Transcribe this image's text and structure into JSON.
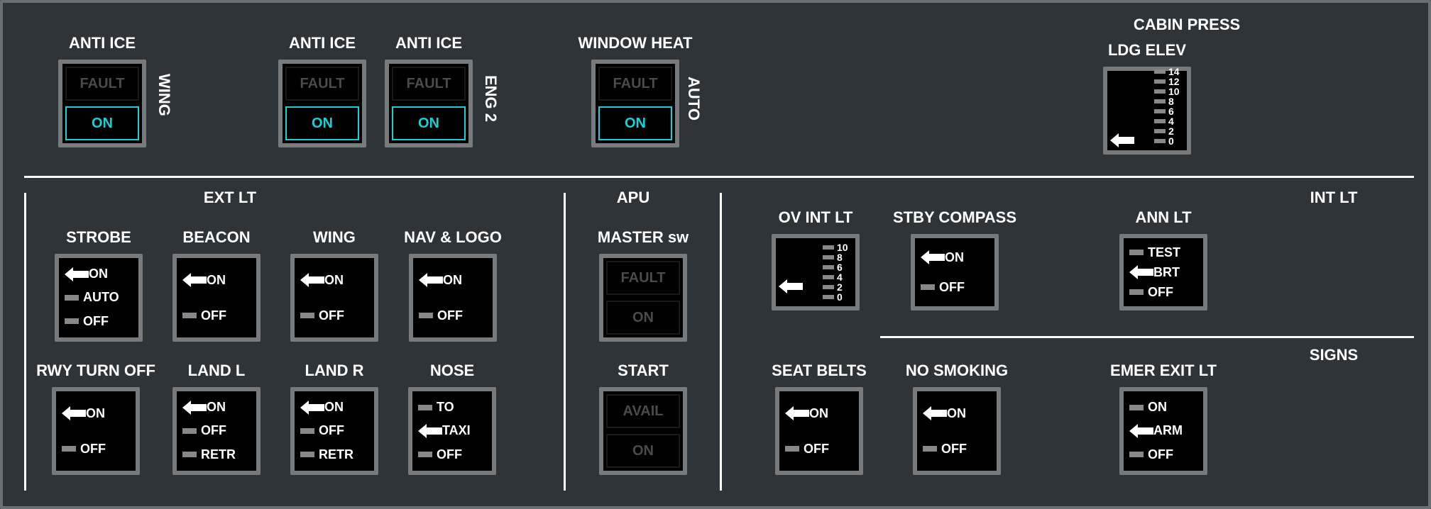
{
  "sections": {
    "cabin_press": "CABIN PRESS",
    "ext_lt": "EXT LT",
    "apu": "APU",
    "int_lt": "INT LT",
    "signs": "SIGNS"
  },
  "anti_ice": {
    "wing": {
      "title": "ANTI ICE",
      "side": "WING",
      "fault": "FAULT",
      "state": "ON"
    },
    "eng1": {
      "title": "ANTI ICE",
      "fault": "FAULT",
      "state": "ON"
    },
    "eng2": {
      "title": "ANTI ICE",
      "side": "ENG 2",
      "fault": "FAULT",
      "state": "ON"
    }
  },
  "window_heat": {
    "title": "WINDOW HEAT",
    "side": "AUTO",
    "fault": "FAULT",
    "state": "ON"
  },
  "ldg_elev": {
    "title": "LDG ELEV",
    "scale": [
      "0",
      "2",
      "4",
      "6",
      "8",
      "10",
      "12",
      "14"
    ],
    "selected_index": 0
  },
  "ext_lt": {
    "strobe": {
      "title": "STROBE",
      "positions": [
        "ON",
        "AUTO",
        "OFF"
      ],
      "selected": "ON"
    },
    "beacon": {
      "title": "BEACON",
      "positions": [
        "ON",
        "OFF"
      ],
      "selected": "ON"
    },
    "wing": {
      "title": "WING",
      "positions": [
        "ON",
        "OFF"
      ],
      "selected": "ON"
    },
    "nav_logo": {
      "title": "NAV & LOGO",
      "positions": [
        "ON",
        "OFF"
      ],
      "selected": "ON"
    },
    "rwy_turn_off": {
      "title": "RWY TURN OFF",
      "positions": [
        "ON",
        "OFF"
      ],
      "selected": "ON"
    },
    "land_l": {
      "title": "LAND L",
      "positions": [
        "ON",
        "OFF",
        "RETR"
      ],
      "selected": "ON"
    },
    "land_r": {
      "title": "LAND R",
      "positions": [
        "ON",
        "OFF",
        "RETR"
      ],
      "selected": "ON"
    },
    "nose": {
      "title": "NOSE",
      "positions": [
        "TO",
        "TAXI",
        "OFF"
      ],
      "selected": "TAXI"
    }
  },
  "apu": {
    "master": {
      "title": "MASTER sw",
      "fault": "FAULT",
      "state": "ON",
      "lit": false
    },
    "start": {
      "title": "START",
      "avail": "AVAIL",
      "state": "ON",
      "lit": false
    }
  },
  "int_lt": {
    "ov_int": {
      "title": "OV INT LT",
      "scale": [
        "0",
        "2",
        "4",
        "6",
        "8",
        "10"
      ],
      "selected_index": 1
    },
    "stby_compass": {
      "title": "STBY COMPASS",
      "positions": [
        "ON",
        "OFF"
      ],
      "selected": "ON"
    },
    "ann_lt": {
      "title": "ANN LT",
      "positions": [
        "TEST",
        "BRT",
        "OFF"
      ],
      "selected": "BRT"
    }
  },
  "signs": {
    "seat_belts": {
      "title": "SEAT BELTS",
      "positions": [
        "ON",
        "OFF"
      ],
      "selected": "ON"
    },
    "no_smoking": {
      "title": "NO SMOKING",
      "positions": [
        "ON",
        "OFF"
      ],
      "selected": "ON"
    },
    "emer_exit": {
      "title": "EMER EXIT LT",
      "positions": [
        "ON",
        "ARM",
        "OFF"
      ],
      "selected": "ARM"
    }
  }
}
